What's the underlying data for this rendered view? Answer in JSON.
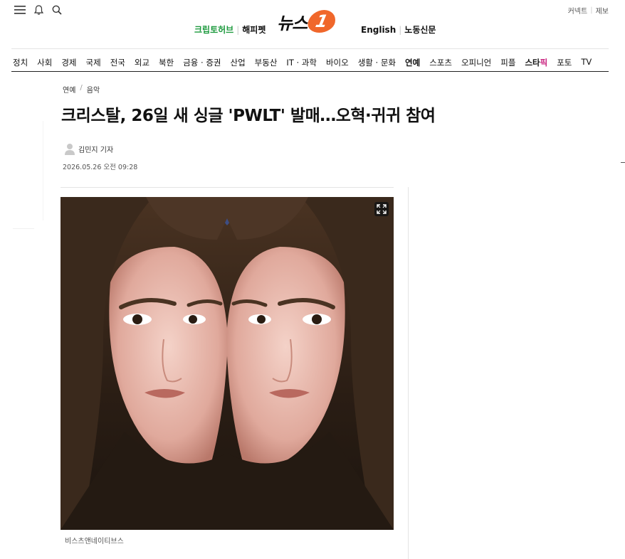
{
  "header": {
    "icons": [
      "menu-icon",
      "bell-icon",
      "search-icon"
    ],
    "right_links": [
      "커넥트",
      "제보"
    ],
    "left_links": [
      "크립토허브",
      "해피펫"
    ],
    "logo_text": "뉴스",
    "logo_badge": "1",
    "right_pills": [
      "English",
      "노동신문"
    ],
    "accent_color": "#f0672b",
    "green_color": "#1d9a3e"
  },
  "nav": {
    "items": [
      "정치",
      "사회",
      "경제",
      "국제",
      "전국",
      "외교",
      "북한",
      "금융 · 증권",
      "산업",
      "부동산",
      "IT · 과학",
      "바이오",
      "생활 · 문화",
      "연예",
      "스포츠",
      "오피니언",
      "피플"
    ],
    "star_prefix": "스타",
    "star_suffix": "픽",
    "tail_items": [
      "포토",
      "TV"
    ],
    "active": "연예"
  },
  "article": {
    "breadcrumb": [
      "연예",
      "음악"
    ],
    "headline": "크리스탈, 26일 새 싱글 'PWLT' 발매…오혁·귀귀 참여",
    "reporter": "김민지 기자",
    "date": "2026.05.26 오전 09:28",
    "photo_caption": "비스츠앤네이티브스"
  }
}
